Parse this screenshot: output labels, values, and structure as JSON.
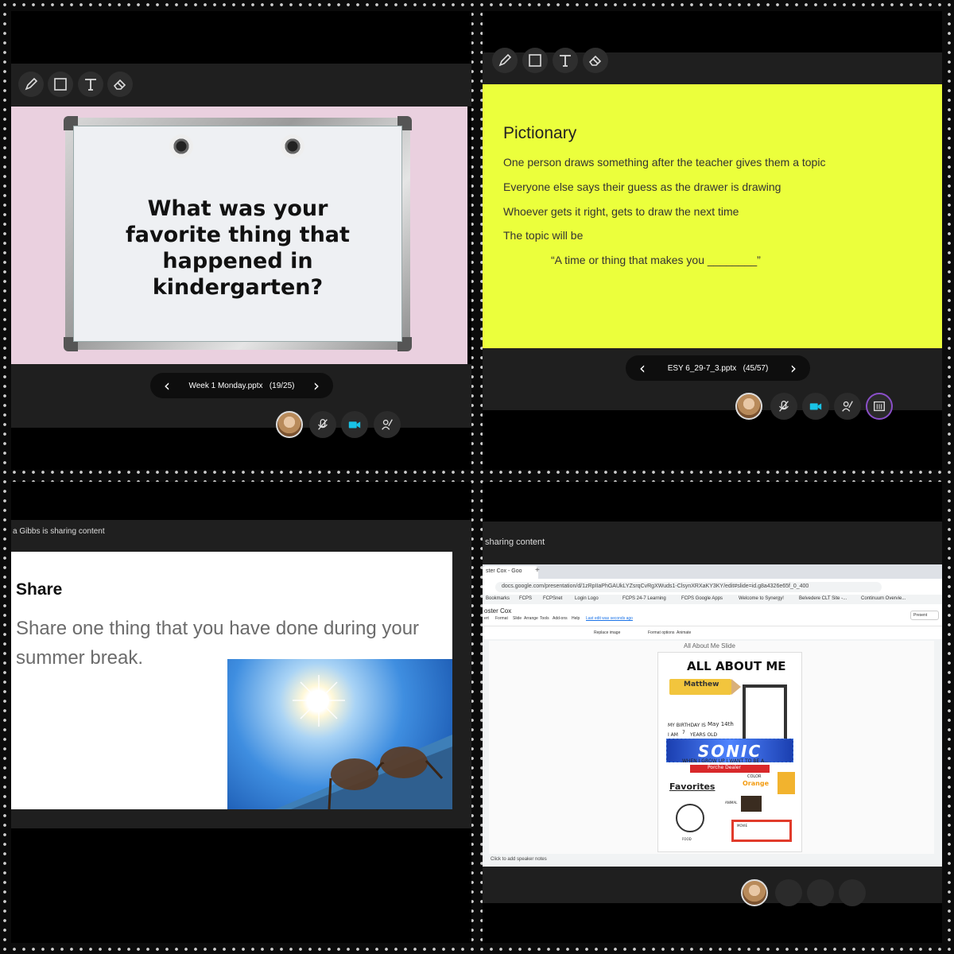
{
  "panel1": {
    "toolbar": [
      "pencil-icon",
      "rectangle-icon",
      "text-icon",
      "eraser-icon"
    ],
    "slide_question": "What was your favorite thing that happened in kindergarten?",
    "file_label": "Week 1 Monday.pptx",
    "page_indicator": "(19/25)",
    "colors": {
      "slide_bg": "#ead0df",
      "board": "#eef0f3"
    }
  },
  "panel2": {
    "toolbar": [
      "pencil-icon",
      "rectangle-icon",
      "text-icon",
      "eraser-icon"
    ],
    "title": "Pictionary",
    "lines": [
      "One person draws something after the teacher gives them a topic",
      "Everyone else says their guess as the drawer is drawing",
      "Whoever gets it right, gets to draw the next time",
      "The topic will be"
    ],
    "topic": "“A time or thing that makes you ________”",
    "file_label": "ESY 6_29-7_3.pptx",
    "page_indicator": "(45/57)",
    "colors": {
      "slide_bg": "#ebff3c"
    }
  },
  "panel3": {
    "sharing_label": "a Gibbs is sharing content",
    "title": "Share",
    "body": "Share one thing that you have done during your summer break."
  },
  "panel4": {
    "sharing_label": "sharing content",
    "tab_title": "ster Cox - Goo",
    "url": "docs.google.com/presentation/d/1zRpIIaPhGAUkLYZsrqCvRgXWuds1-ClsynXRXaKY3KY/edit#slide=id.g8a4326e65f_0_400",
    "bookmarks": [
      "Bookmarks",
      "FCPS",
      "FCPSnet",
      "Login Logo",
      "FCPS 24-7 Learning",
      "FCPS Google Apps",
      "Welcome to Synergy!",
      "Belvedere CLT Site -...",
      "Continuum Overvie..."
    ],
    "doc_title": "oster Cox",
    "menu": [
      "ert",
      "Format",
      "Slide",
      "Arrange",
      "Tools",
      "Add-ons",
      "Help",
      "Last edit was seconds ago"
    ],
    "toolbar_items": [
      "Replace image",
      "Format options",
      "Animate"
    ],
    "present_label": "Present",
    "slide_heading": "All About Me Slide",
    "poster": {
      "title": "ALL ABOUT ME",
      "name": "Matthew",
      "birthday_label": "MY BIRTHDAY IS",
      "birthday": "May 14th",
      "age_label": "I AM",
      "age": "7",
      "years_old": "YEARS OLD",
      "grow_up_label": "WHEN I GROW UP I WANT TO BE A...",
      "grow_up": "Porche Dealer",
      "favorite_show": "SONIC",
      "favorites_label": "Favorites",
      "color_label": "COLOR",
      "color": "Orange",
      "animal_label": "ANIMAL",
      "food_label": "FOOD",
      "movie_label": "MOVIE"
    },
    "speaker_notes": "Click to add speaker notes"
  }
}
